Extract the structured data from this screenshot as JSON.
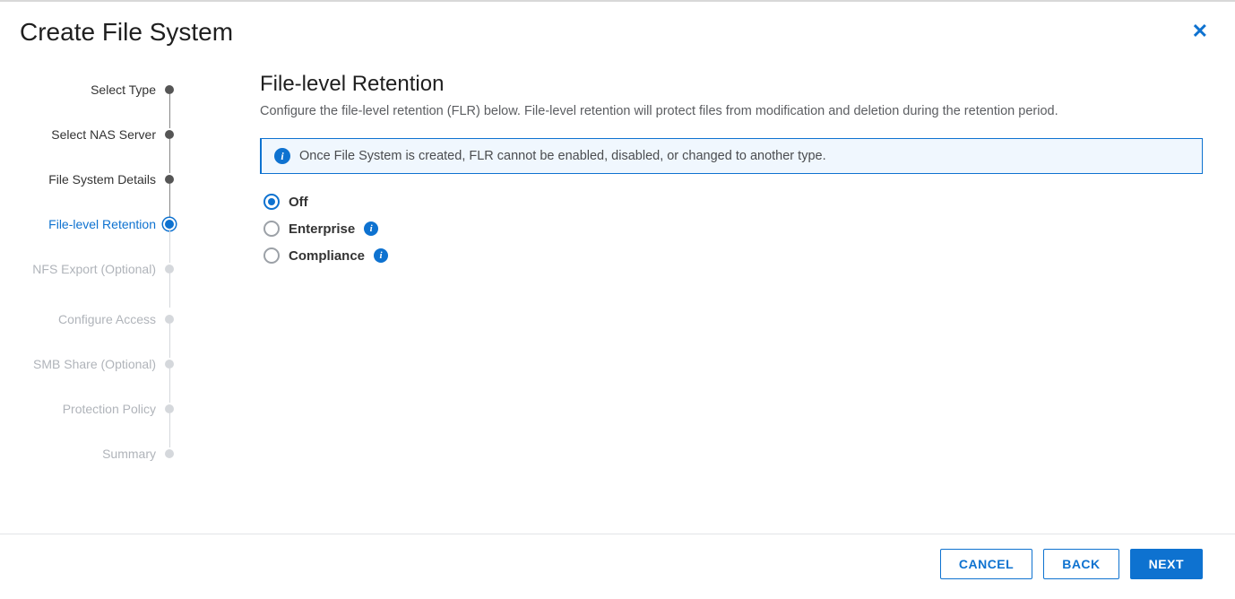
{
  "dialog": {
    "title": "Create File System"
  },
  "steps": [
    {
      "label": "Select Type",
      "state": "completed"
    },
    {
      "label": "Select NAS Server",
      "state": "completed"
    },
    {
      "label": "File System Details",
      "state": "completed"
    },
    {
      "label": "File-level Retention",
      "state": "active"
    },
    {
      "label": "NFS Export (Optional)",
      "state": "future",
      "multiline": true
    },
    {
      "label": "Configure Access",
      "state": "future"
    },
    {
      "label": "SMB Share (Optional)",
      "state": "future"
    },
    {
      "label": "Protection Policy",
      "state": "future"
    },
    {
      "label": "Summary",
      "state": "future"
    }
  ],
  "panel": {
    "heading": "File-level Retention",
    "description": "Configure the file-level retention (FLR) below. File-level retention will protect files from modification and deletion during the retention period.",
    "info_message": "Once File System is created, FLR cannot be enabled, disabled, or changed to another type."
  },
  "options": {
    "off": {
      "label": "Off",
      "selected": true,
      "has_help": false
    },
    "enterprise": {
      "label": "Enterprise",
      "selected": false,
      "has_help": true
    },
    "compliance": {
      "label": "Compliance",
      "selected": false,
      "has_help": true
    }
  },
  "footer": {
    "cancel": "CANCEL",
    "back": "BACK",
    "next": "NEXT"
  }
}
